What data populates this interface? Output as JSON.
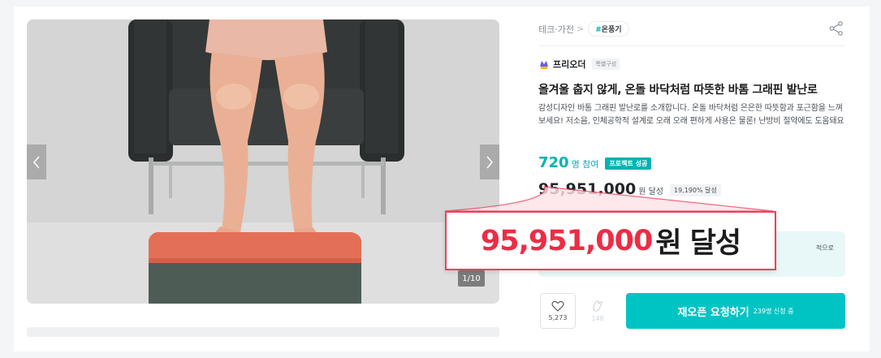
{
  "breadcrumb": {
    "category": "테크·가전",
    "separator": ">",
    "tag_hash": "#",
    "tag": "온풍기"
  },
  "maker": {
    "name": "프리오더",
    "badge": "특별구성"
  },
  "project": {
    "title": "올겨울 춥지 않게, 온돌 바닥처럼 따뜻한 바톰 그래핀 발난로",
    "description": "감성디자인 바톰 그래핀 발난로를 소개합니다. 온돌 바닥처럼 은은한 따뜻함과 포근함을 느껴보세요! 저소음, 인체공학적 설계로 오래 오래 편하게 사용은 물론! 난방비 절약에도 도움돼요"
  },
  "stats": {
    "participants": "720",
    "participants_unit": "명 참여",
    "success_badge": "프로젝트 성공",
    "amount": "95,951,000",
    "amount_unit": "원 달성",
    "percent": "19,190% 달성"
  },
  "notice": {
    "text_fragment": "적으로"
  },
  "gallery": {
    "counter": "1/10"
  },
  "actions": {
    "wish_count": "5,273",
    "cheer_count": "148",
    "reopen_label": "재오픈 요청하기",
    "reopen_sub": "239명 신청 중"
  },
  "highlight": {
    "amount": "95,951,000",
    "suffix": "원 달성"
  },
  "colors": {
    "accent": "#00c4c4",
    "highlight_red": "#ee2c45",
    "callout_border": "#f13f5c"
  },
  "icons": {
    "share": "share-icon",
    "wish": "heart-icon",
    "cheer": "clap-icon",
    "prev": "chevron-left-icon",
    "next": "chevron-right-icon",
    "maker": "maker-logo-icon"
  }
}
